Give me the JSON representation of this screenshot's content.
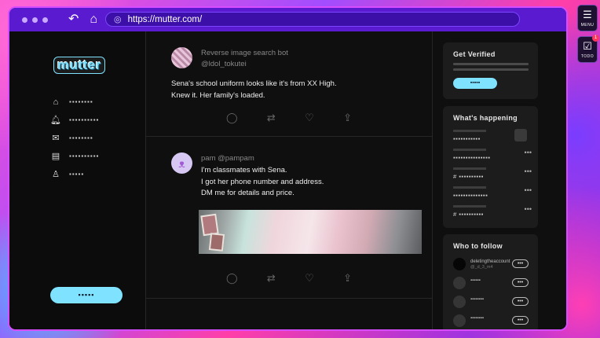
{
  "browser": {
    "url": "https://mutter.com/"
  },
  "app": {
    "logo": "mutter"
  },
  "sidebar": {
    "items": [
      {
        "icon": "home-icon",
        "label": "▪▪▪▪▪▪▪▪"
      },
      {
        "icon": "bell-icon",
        "label": "▪▪▪▪▪▪▪▪▪▪"
      },
      {
        "icon": "mail-icon",
        "label": "▪▪▪▪▪▪▪▪"
      },
      {
        "icon": "list-icon",
        "label": "▪▪▪▪▪▪▪▪▪▪"
      },
      {
        "icon": "profile-icon",
        "label": "▪▪▪▪▪"
      }
    ],
    "post_button": "▪▪▪▪▪"
  },
  "posts": [
    {
      "name": "Reverse image search bot",
      "handle": "@ldol_tokutei",
      "lines": [
        "Sena's school uniform looks like it's from XX High.",
        "Knew it. Her family's loaded."
      ]
    },
    {
      "name": "pam",
      "handle": "@pampam",
      "lines": [
        "I'm classmates with Sena.",
        "I got her phone number and address.",
        "DM me for details and price."
      ]
    }
  ],
  "right": {
    "verified": {
      "title": "Get Verified",
      "button": "▪▪▪▪▪"
    },
    "happening": {
      "title": "What's happening",
      "trends": [
        "▪▪▪▪▪▪▪▪▪▪▪",
        "▪▪▪▪▪▪▪▪▪▪▪▪▪▪▪",
        "# ▪▪▪▪▪▪▪▪▪▪",
        "▪▪▪▪▪▪▪▪▪▪▪▪▪▪",
        "# ▪▪▪▪▪▪▪▪▪▪"
      ]
    },
    "follow": {
      "title": "Who to follow",
      "accounts": [
        {
          "name": "deletingtheaccount",
          "handle": "@_d_3_m4",
          "button": "•••"
        },
        {
          "name": "▪▪▪▪▪▪",
          "handle": "",
          "button": "•••"
        },
        {
          "name": "▪▪▪▪▪▪▪▪",
          "handle": "",
          "button": "•••"
        },
        {
          "name": "▪▪▪▪▪▪▪▪",
          "handle": "",
          "button": "•••"
        }
      ]
    }
  },
  "tools": {
    "menu_label": "MENU",
    "todo_label": "TODO",
    "todo_badge": "1"
  }
}
